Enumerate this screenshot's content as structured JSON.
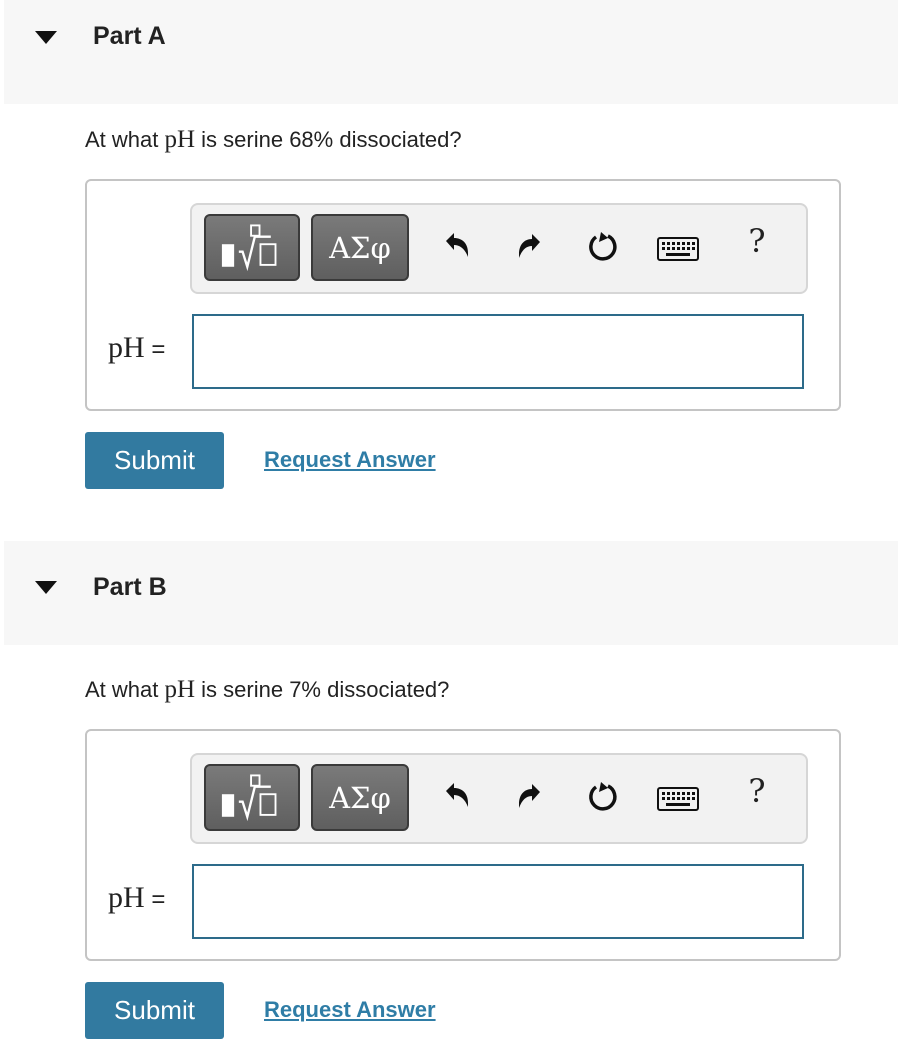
{
  "parts": [
    {
      "title": "Part A",
      "question_prefix": "At what ",
      "question_math": "pH",
      "question_suffix": " is serine 68% dissociated?",
      "answer_label": "pH",
      "answer_equals": " =",
      "answer_value": "",
      "submit_label": "Submit",
      "request_label": "Request Answer"
    },
    {
      "title": "Part B",
      "question_prefix": "At what ",
      "question_math": "pH",
      "question_suffix": " is serine 7% dissociated?",
      "answer_label": "pH",
      "answer_equals": " =",
      "answer_value": "",
      "submit_label": "Submit",
      "request_label": "Request Answer"
    }
  ],
  "toolbar": {
    "greek_label": "ΑΣφ",
    "help_label": "?",
    "icons": [
      "templates-icon",
      "undo-icon",
      "redo-icon",
      "reset-icon",
      "keyboard-icon",
      "help-icon"
    ]
  },
  "colors": {
    "accent": "#327aa0",
    "link": "#2f7da6",
    "input_border": "#2d6b8a",
    "header_bg": "#f7f7f7"
  }
}
